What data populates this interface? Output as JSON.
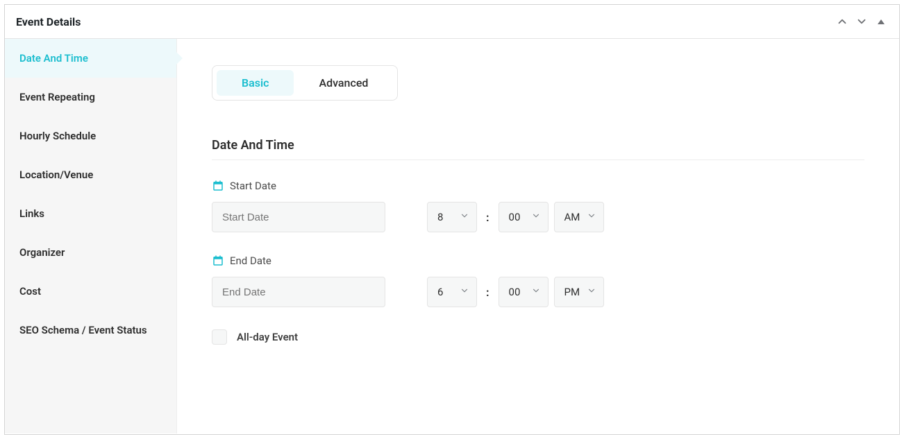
{
  "header": {
    "title": "Event Details"
  },
  "sidebar": {
    "items": [
      {
        "label": "Date And Time"
      },
      {
        "label": "Event Repeating"
      },
      {
        "label": "Hourly Schedule"
      },
      {
        "label": "Location/Venue"
      },
      {
        "label": "Links"
      },
      {
        "label": "Organizer"
      },
      {
        "label": "Cost"
      },
      {
        "label": "SEO Schema / Event Status"
      }
    ]
  },
  "tabs": {
    "basic": "Basic",
    "advanced": "Advanced"
  },
  "section": {
    "title": "Date And Time"
  },
  "start": {
    "label": "Start Date",
    "placeholder": "Start Date",
    "hour": "8",
    "minute": "00",
    "period": "AM"
  },
  "end": {
    "label": "End Date",
    "placeholder": "End Date",
    "hour": "6",
    "minute": "00",
    "period": "PM"
  },
  "allday": {
    "label": "All-day Event"
  },
  "colon": ":"
}
